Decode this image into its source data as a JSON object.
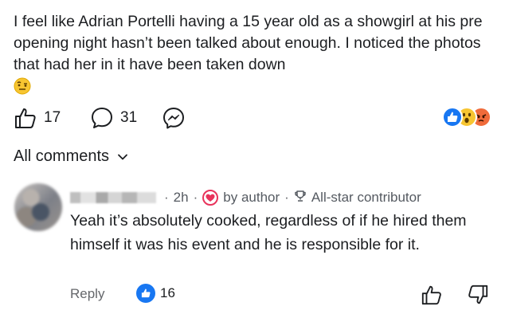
{
  "post": {
    "text": "I feel like Adrian Portelli having a 15 year old as a showgirl at his pre opening night hasn’t been talked about enough. I noticed the photos that had her in it have been taken down",
    "emoji": "raised-eyebrow-emoji"
  },
  "actions": {
    "like_count": "17",
    "comment_count": "31",
    "like_icon": "thumb-up-outline-icon",
    "comment_icon": "speech-bubble-icon",
    "share_icon": "messenger-icon",
    "reactions": [
      "like-icon",
      "wow-icon",
      "angry-icon"
    ]
  },
  "comments_header": {
    "label": "All comments",
    "icon": "chevron-down-icon"
  },
  "comment": {
    "time": "2h",
    "by_author": "by author",
    "badge": "All-star contributor",
    "text": "Yeah it’s absolutely cooked, regardless of if he hired them himself it was his event and he is responsible for it.",
    "reply_label": "Reply",
    "like_count": "16"
  },
  "colors": {
    "brand_blue": "#1877f2",
    "heart_red": "#e8335b",
    "text": "#1c1e21",
    "muted": "#65676b"
  }
}
